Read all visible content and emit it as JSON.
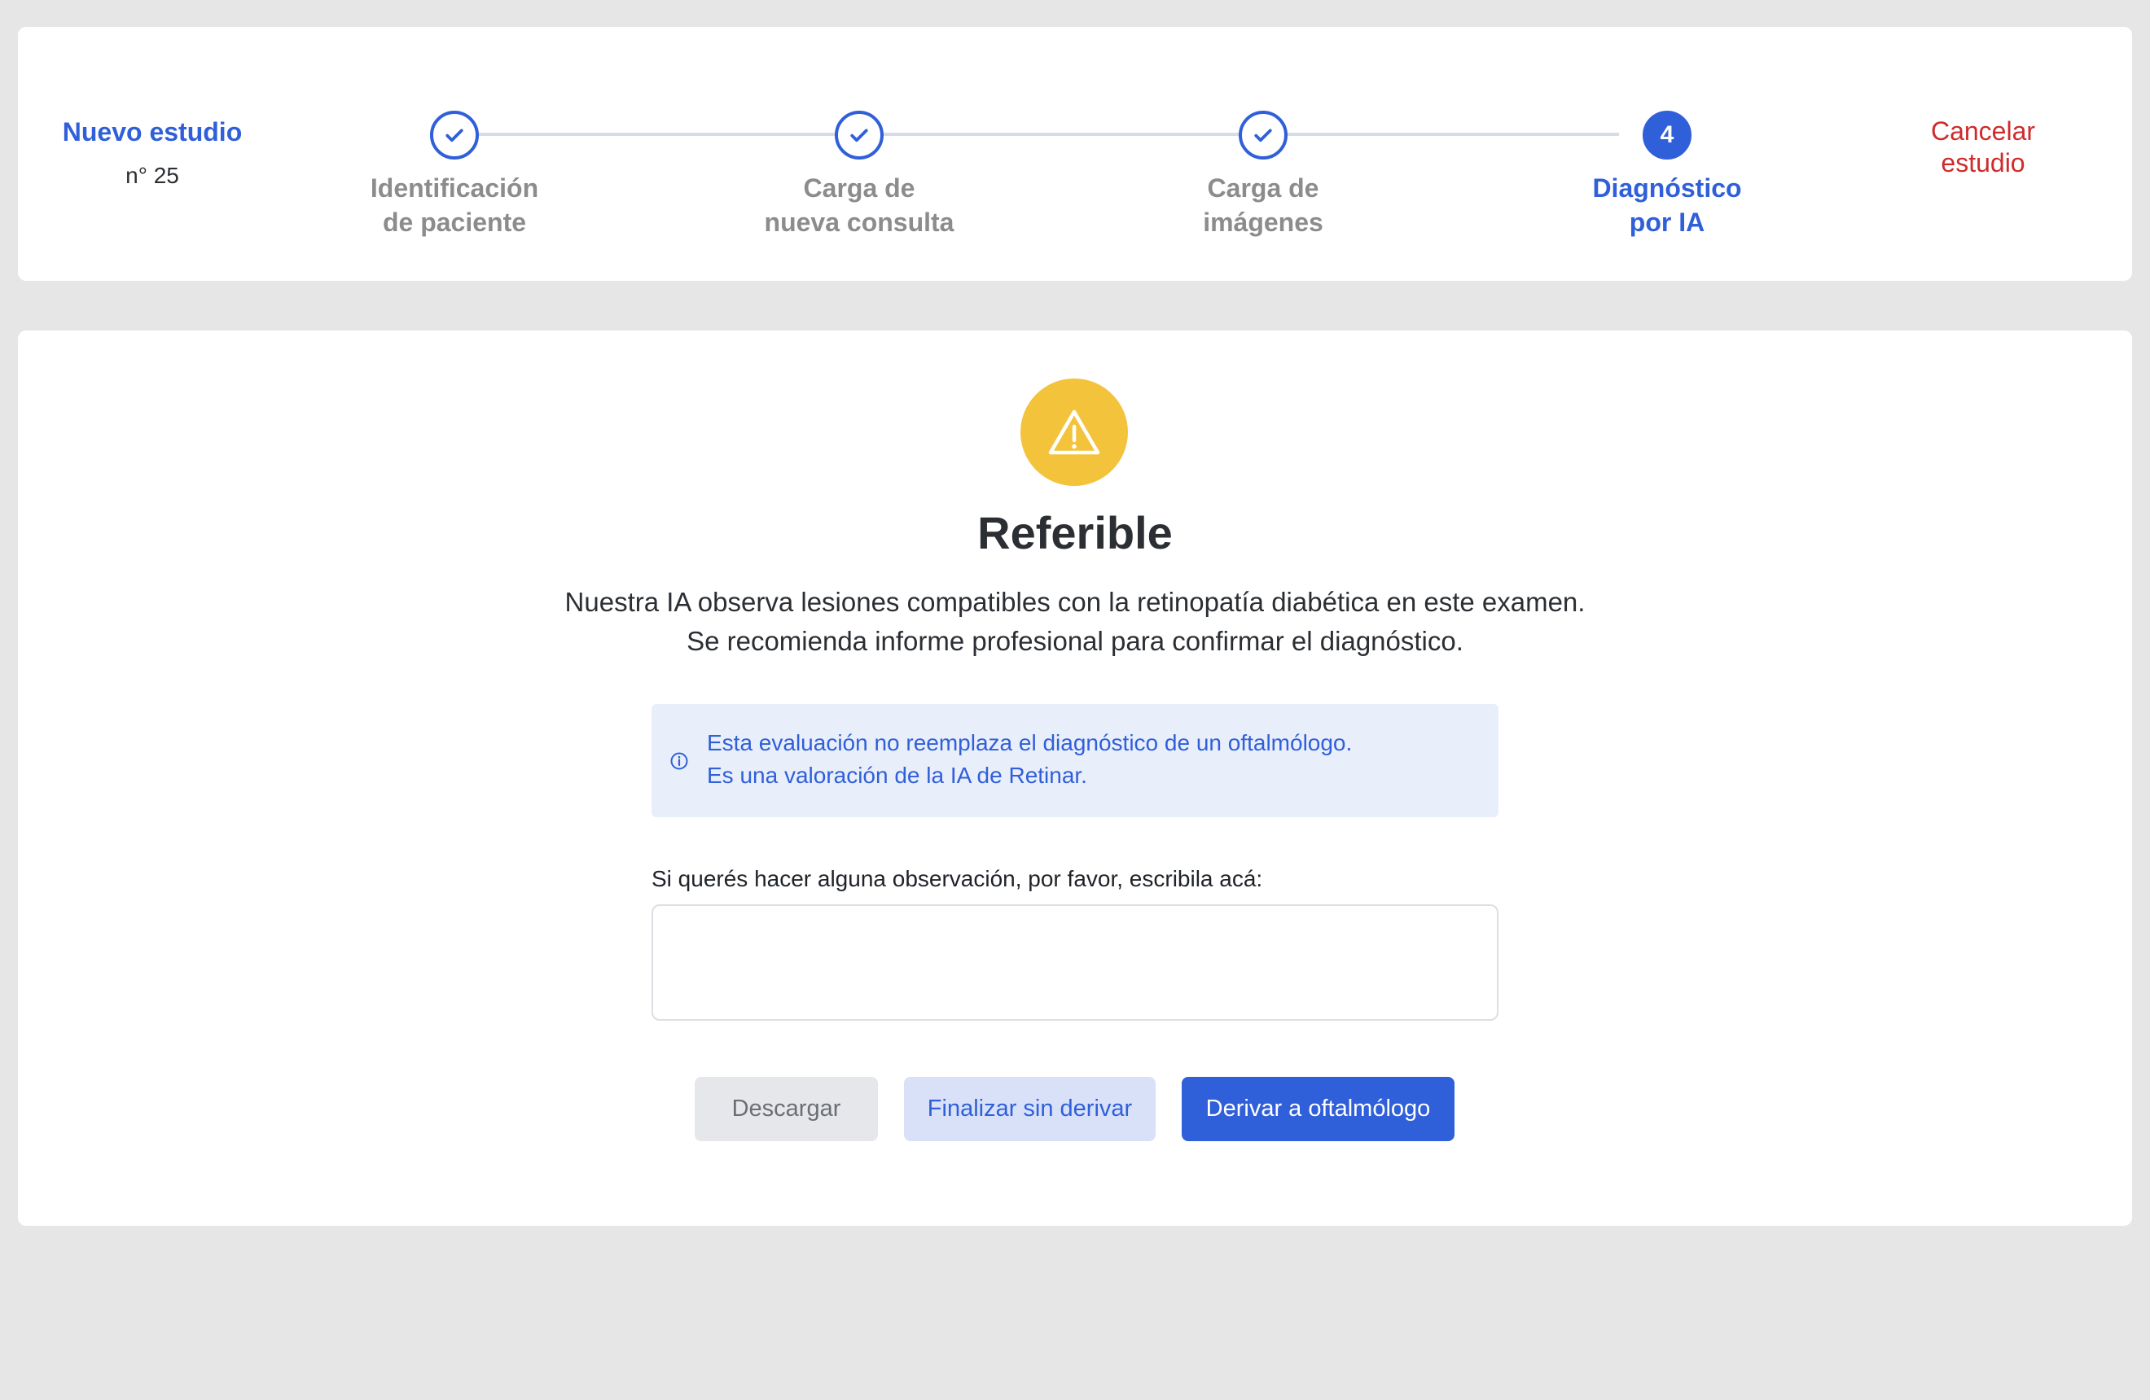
{
  "header": {
    "study_title": "Nuevo estudio",
    "study_number": "n° 25",
    "cancel_label": "Cancelar\nestudio",
    "steps": [
      {
        "label": "Identificación\nde paciente",
        "status": "done"
      },
      {
        "label": "Carga de\nnueva consulta",
        "status": "done"
      },
      {
        "label": "Carga de\nimágenes",
        "status": "done"
      },
      {
        "label": "Diagnóstico\npor IA",
        "status": "active",
        "number": "4"
      }
    ]
  },
  "result": {
    "icon": "warning-icon",
    "title": "Referible",
    "description_line1": "Nuestra IA observa lesiones compatibles con la retinopatía diabética en este examen.",
    "description_line2": "Se recomienda informe profesional para confirmar el diagnóstico."
  },
  "notice": {
    "icon": "info-icon",
    "line1": "Esta evaluación no reemplaza el diagnóstico de un oftalmólogo.",
    "line2": "Es una valoración de la IA de Retinar."
  },
  "observation": {
    "label": "Si querés hacer alguna observación, por favor, escribila acá:",
    "value": "",
    "placeholder": ""
  },
  "actions": {
    "download_label": "Descargar",
    "finish_label": "Finalizar sin derivar",
    "refer_label": "Derivar a oftalmólogo"
  },
  "colors": {
    "accent": "#2f5fd9",
    "danger": "#cf2b2b",
    "warning": "#f3c33c",
    "page_background": "#e6e6e6"
  }
}
